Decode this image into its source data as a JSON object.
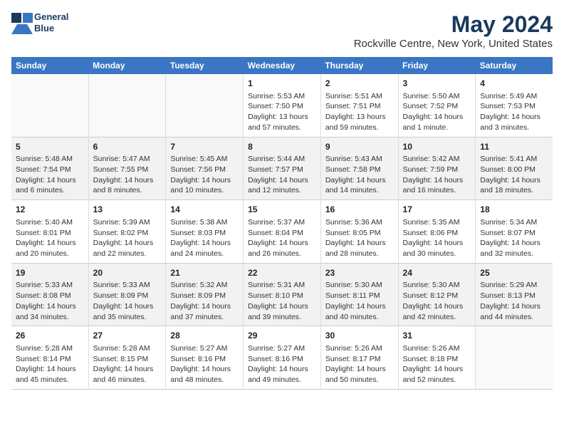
{
  "header": {
    "logo_line1": "General",
    "logo_line2": "Blue",
    "title": "May 2024",
    "subtitle": "Rockville Centre, New York, United States"
  },
  "days_of_week": [
    "Sunday",
    "Monday",
    "Tuesday",
    "Wednesday",
    "Thursday",
    "Friday",
    "Saturday"
  ],
  "weeks": [
    [
      {
        "day": "",
        "info": ""
      },
      {
        "day": "",
        "info": ""
      },
      {
        "day": "",
        "info": ""
      },
      {
        "day": "1",
        "info": "Sunrise: 5:53 AM\nSunset: 7:50 PM\nDaylight: 13 hours\nand 57 minutes."
      },
      {
        "day": "2",
        "info": "Sunrise: 5:51 AM\nSunset: 7:51 PM\nDaylight: 13 hours\nand 59 minutes."
      },
      {
        "day": "3",
        "info": "Sunrise: 5:50 AM\nSunset: 7:52 PM\nDaylight: 14 hours\nand 1 minute."
      },
      {
        "day": "4",
        "info": "Sunrise: 5:49 AM\nSunset: 7:53 PM\nDaylight: 14 hours\nand 3 minutes."
      }
    ],
    [
      {
        "day": "5",
        "info": "Sunrise: 5:48 AM\nSunset: 7:54 PM\nDaylight: 14 hours\nand 6 minutes."
      },
      {
        "day": "6",
        "info": "Sunrise: 5:47 AM\nSunset: 7:55 PM\nDaylight: 14 hours\nand 8 minutes."
      },
      {
        "day": "7",
        "info": "Sunrise: 5:45 AM\nSunset: 7:56 PM\nDaylight: 14 hours\nand 10 minutes."
      },
      {
        "day": "8",
        "info": "Sunrise: 5:44 AM\nSunset: 7:57 PM\nDaylight: 14 hours\nand 12 minutes."
      },
      {
        "day": "9",
        "info": "Sunrise: 5:43 AM\nSunset: 7:58 PM\nDaylight: 14 hours\nand 14 minutes."
      },
      {
        "day": "10",
        "info": "Sunrise: 5:42 AM\nSunset: 7:59 PM\nDaylight: 14 hours\nand 16 minutes."
      },
      {
        "day": "11",
        "info": "Sunrise: 5:41 AM\nSunset: 8:00 PM\nDaylight: 14 hours\nand 18 minutes."
      }
    ],
    [
      {
        "day": "12",
        "info": "Sunrise: 5:40 AM\nSunset: 8:01 PM\nDaylight: 14 hours\nand 20 minutes."
      },
      {
        "day": "13",
        "info": "Sunrise: 5:39 AM\nSunset: 8:02 PM\nDaylight: 14 hours\nand 22 minutes."
      },
      {
        "day": "14",
        "info": "Sunrise: 5:38 AM\nSunset: 8:03 PM\nDaylight: 14 hours\nand 24 minutes."
      },
      {
        "day": "15",
        "info": "Sunrise: 5:37 AM\nSunset: 8:04 PM\nDaylight: 14 hours\nand 26 minutes."
      },
      {
        "day": "16",
        "info": "Sunrise: 5:36 AM\nSunset: 8:05 PM\nDaylight: 14 hours\nand 28 minutes."
      },
      {
        "day": "17",
        "info": "Sunrise: 5:35 AM\nSunset: 8:06 PM\nDaylight: 14 hours\nand 30 minutes."
      },
      {
        "day": "18",
        "info": "Sunrise: 5:34 AM\nSunset: 8:07 PM\nDaylight: 14 hours\nand 32 minutes."
      }
    ],
    [
      {
        "day": "19",
        "info": "Sunrise: 5:33 AM\nSunset: 8:08 PM\nDaylight: 14 hours\nand 34 minutes."
      },
      {
        "day": "20",
        "info": "Sunrise: 5:33 AM\nSunset: 8:09 PM\nDaylight: 14 hours\nand 35 minutes."
      },
      {
        "day": "21",
        "info": "Sunrise: 5:32 AM\nSunset: 8:09 PM\nDaylight: 14 hours\nand 37 minutes."
      },
      {
        "day": "22",
        "info": "Sunrise: 5:31 AM\nSunset: 8:10 PM\nDaylight: 14 hours\nand 39 minutes."
      },
      {
        "day": "23",
        "info": "Sunrise: 5:30 AM\nSunset: 8:11 PM\nDaylight: 14 hours\nand 40 minutes."
      },
      {
        "day": "24",
        "info": "Sunrise: 5:30 AM\nSunset: 8:12 PM\nDaylight: 14 hours\nand 42 minutes."
      },
      {
        "day": "25",
        "info": "Sunrise: 5:29 AM\nSunset: 8:13 PM\nDaylight: 14 hours\nand 44 minutes."
      }
    ],
    [
      {
        "day": "26",
        "info": "Sunrise: 5:28 AM\nSunset: 8:14 PM\nDaylight: 14 hours\nand 45 minutes."
      },
      {
        "day": "27",
        "info": "Sunrise: 5:28 AM\nSunset: 8:15 PM\nDaylight: 14 hours\nand 46 minutes."
      },
      {
        "day": "28",
        "info": "Sunrise: 5:27 AM\nSunset: 8:16 PM\nDaylight: 14 hours\nand 48 minutes."
      },
      {
        "day": "29",
        "info": "Sunrise: 5:27 AM\nSunset: 8:16 PM\nDaylight: 14 hours\nand 49 minutes."
      },
      {
        "day": "30",
        "info": "Sunrise: 5:26 AM\nSunset: 8:17 PM\nDaylight: 14 hours\nand 50 minutes."
      },
      {
        "day": "31",
        "info": "Sunrise: 5:26 AM\nSunset: 8:18 PM\nDaylight: 14 hours\nand 52 minutes."
      },
      {
        "day": "",
        "info": ""
      }
    ]
  ]
}
